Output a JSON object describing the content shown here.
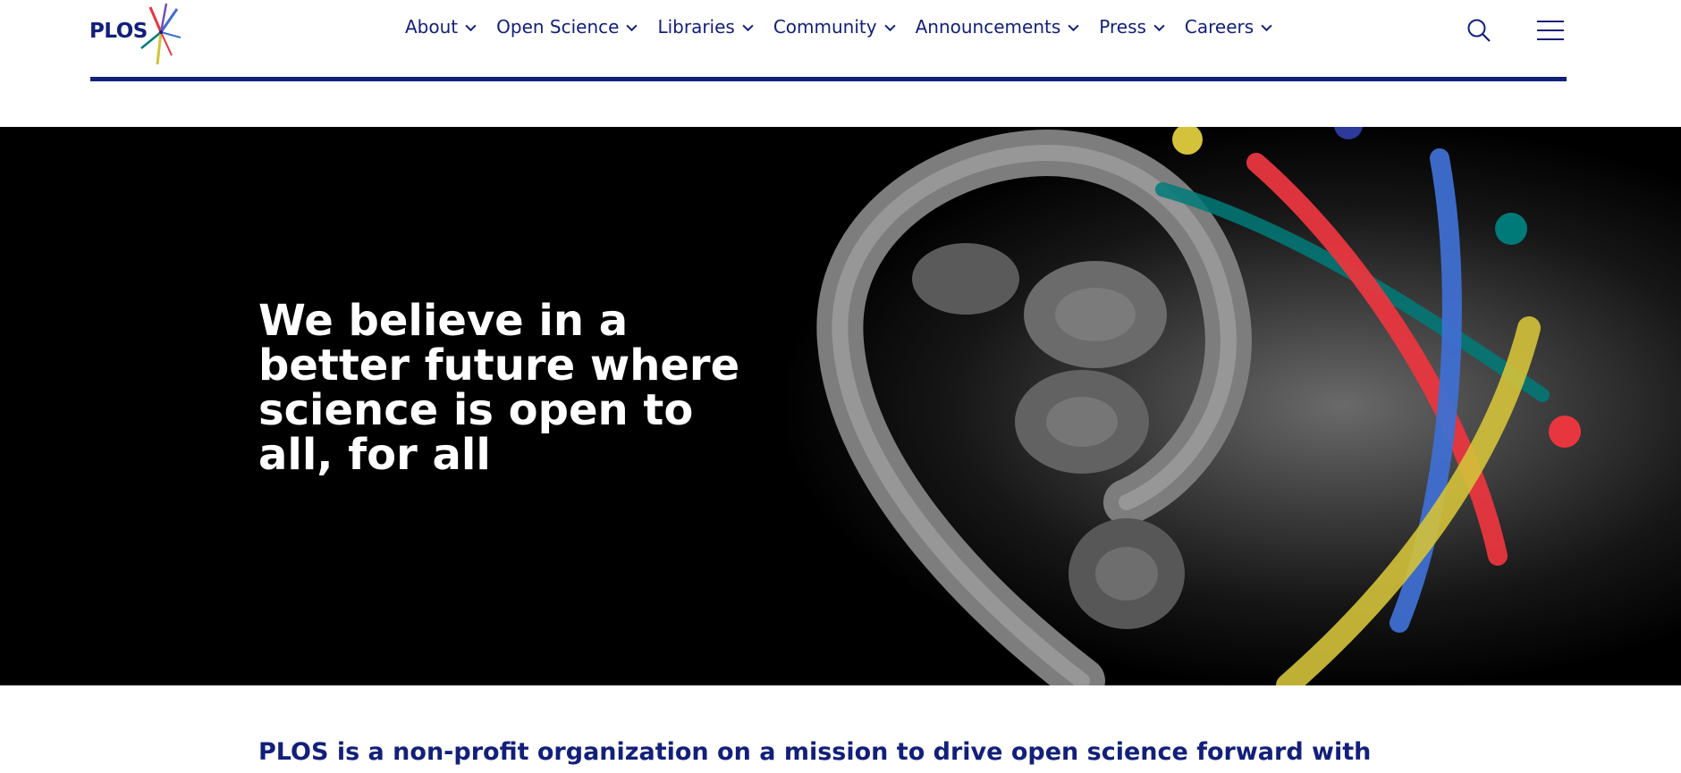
{
  "brand": {
    "logo_text": "PLOS",
    "primary_color": "#12207a"
  },
  "nav": {
    "items": [
      {
        "label": "About"
      },
      {
        "label": "Open Science"
      },
      {
        "label": "Libraries"
      },
      {
        "label": "Community"
      },
      {
        "label": "Announcements"
      },
      {
        "label": "Press"
      },
      {
        "label": "Careers"
      }
    ],
    "icons": [
      "search-icon",
      "hamburger-menu-icon"
    ]
  },
  "hero": {
    "title": "We believe in a better future where science is open to all, for all",
    "accent_colors": [
      "#e8363f",
      "#3f6fd1",
      "#007a78",
      "#d4c23a"
    ]
  },
  "mission": {
    "text": "PLOS is a non-profit organization on a mission to drive open science forward with"
  }
}
